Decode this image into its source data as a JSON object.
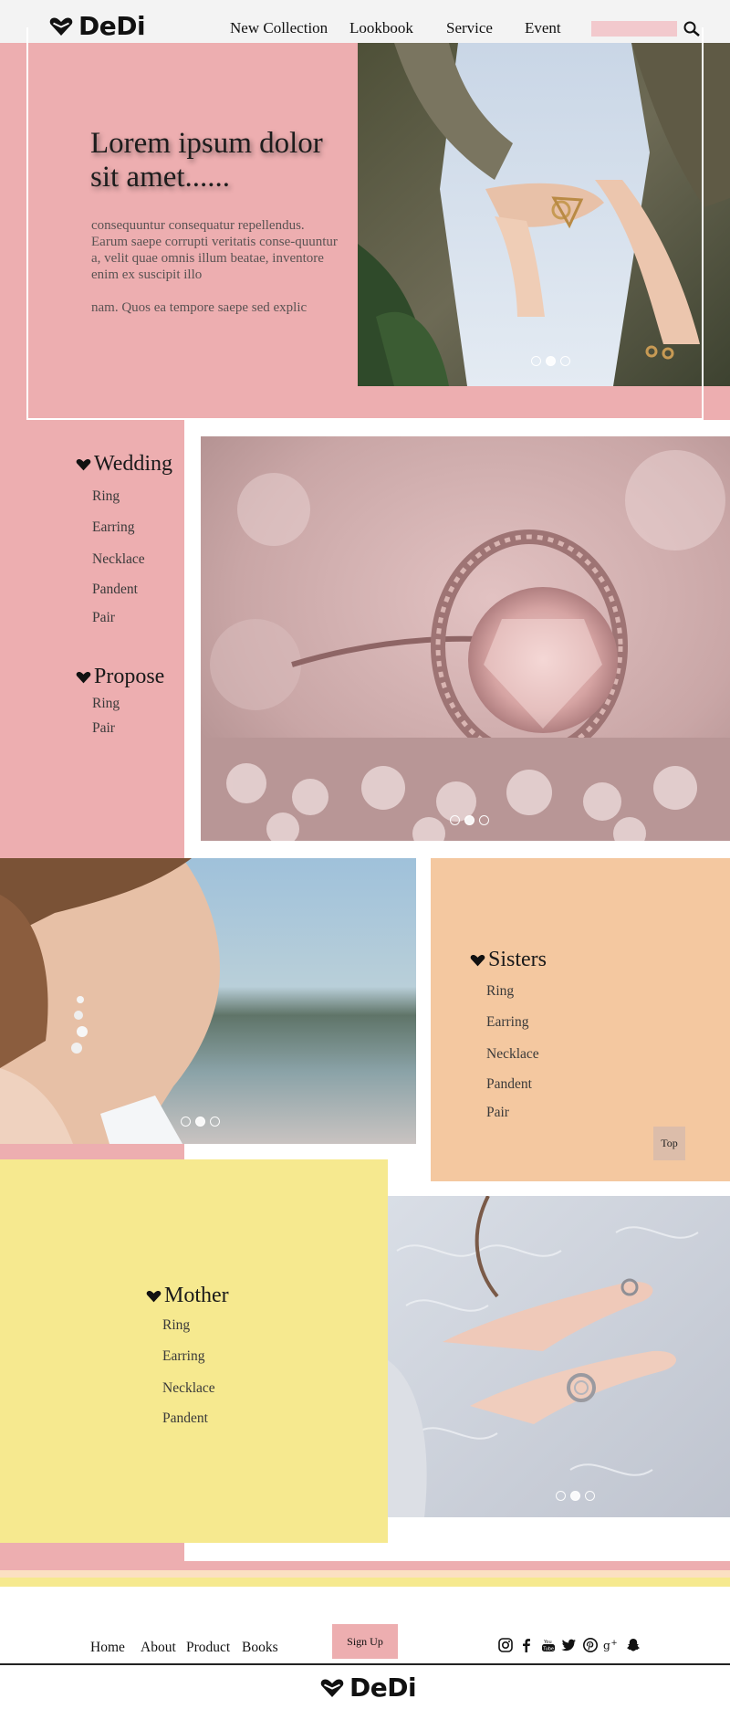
{
  "header": {
    "brand": "DeDi",
    "nav": [
      "New Collection",
      "Lookbook",
      "Service",
      "Event"
    ],
    "search_placeholder": ""
  },
  "hero": {
    "title": "Lorem ipsum dolor sit amet......",
    "paragraph1": "consequuntur consequatur repellendus. Earum saepe corrupti veritatis conse-quuntur a, velit quae omnis illum beatae, inventore enim ex suscipit illo",
    "paragraph2": "nam. Quos ea tempore saepe sed explic",
    "slider_active": 2
  },
  "wedding": {
    "title": "Wedding",
    "items": [
      "Ring",
      "Earring",
      "Necklace",
      "Pandent",
      "Pair"
    ],
    "slider_active": 2
  },
  "propose": {
    "title": "Propose",
    "items": [
      "Ring",
      "Pair"
    ]
  },
  "sisters": {
    "title": "Sisters",
    "items": [
      "Ring",
      "Earring",
      "Necklace",
      "Pandent",
      "Pair"
    ],
    "slider_active": 2,
    "top_button": "Top"
  },
  "mother": {
    "title": "Mother",
    "items": [
      "Ring",
      "Earring",
      "Necklace",
      "Pandent"
    ],
    "slider_active": 2
  },
  "footer": {
    "links": [
      "Home",
      "About",
      "Product",
      "Books"
    ],
    "signup_label": "Sign Up",
    "social_icons": [
      "instagram-icon",
      "facebook-icon",
      "youtube-icon",
      "twitter-icon",
      "pinterest-icon",
      "google-plus-icon",
      "snapchat-icon"
    ],
    "brand": "DeDi"
  },
  "colors": {
    "pink": "#edaeb0",
    "peach": "#f4c8a0",
    "yellow": "#f6e98f",
    "header_bg": "#f3f3f3"
  }
}
